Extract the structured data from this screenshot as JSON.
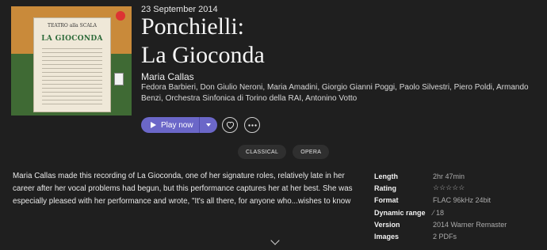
{
  "album": {
    "release_date": "23 September 2014",
    "title_line1": "Ponchielli:",
    "title_line2": "La Gioconda",
    "artist": "Maria Callas",
    "performers": "Fedora Barbieri, Don Giulio Neroni, Maria Amadini, Giorgio Gianni Poggi, Paolo Silvestri, Piero Poldi, Armando Benzi, Orchestra Sinfonica di Torino della RAI, Antonino Votto",
    "cover": {
      "header_text": "TEATRO alla SCALA",
      "poster_title": "LA GIOCONDA",
      "colors": {
        "top": "#c98a3a",
        "bottom": "#3f6a34"
      }
    }
  },
  "actions": {
    "play_label": "Play now",
    "accent_color": "#6b67c8",
    "heart_icon": "heart-icon",
    "more_icon": "more-icon"
  },
  "tags": [
    "CLASSICAL",
    "OPERA"
  ],
  "description": "Maria Callas made this recording of La Gioconda, one of her signature roles, relatively late in her career after her vocal problems had begun, but this performance captures her at her best. She was especially pleased with her performance and wrote, \"It's all there, for anyone who...wishes to know",
  "specs": [
    {
      "key": "Length",
      "value": "2hr 47min"
    },
    {
      "key": "Rating",
      "value": "☆☆☆☆☆"
    },
    {
      "key": "Format",
      "value": "FLAC 96kHz 24bit"
    },
    {
      "key": "Dynamic range",
      "value": "⁄ 18"
    },
    {
      "key": "Version",
      "value": "2014 Warner Remaster"
    },
    {
      "key": "Images",
      "value": "2 PDFs"
    }
  ]
}
